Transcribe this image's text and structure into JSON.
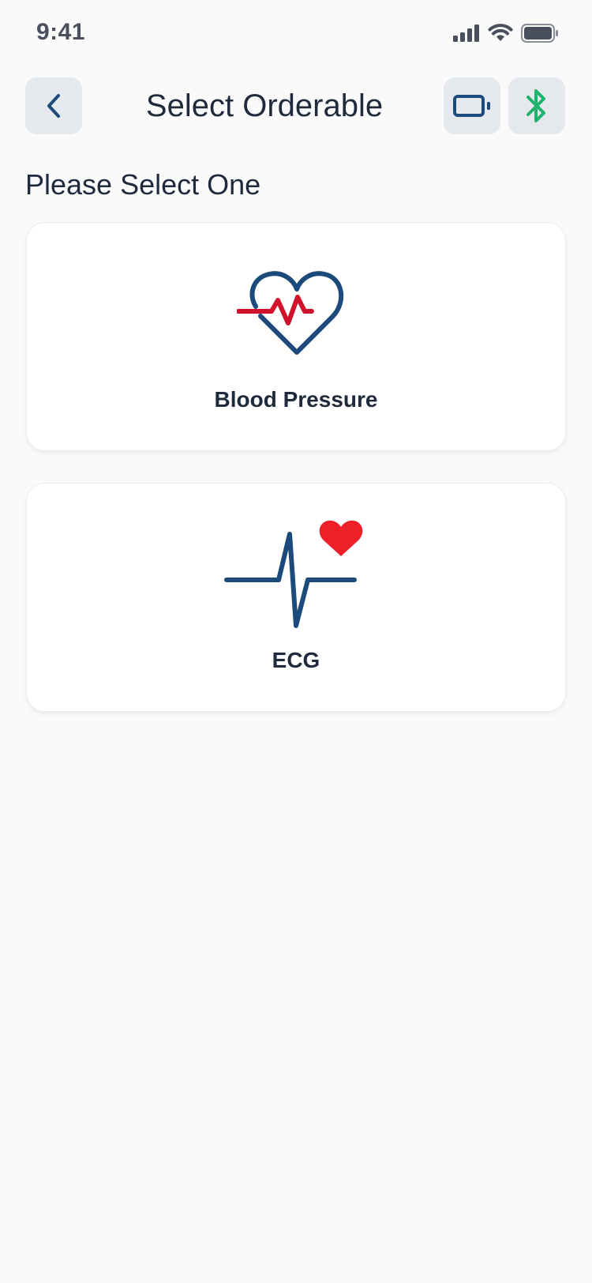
{
  "status_bar": {
    "time": "9:41"
  },
  "header": {
    "title": "Select Orderable",
    "back_icon": "chevron-left-icon",
    "device_icon": "device-icon",
    "bluetooth_icon": "bluetooth-icon"
  },
  "main": {
    "heading": "Please Select One",
    "options": [
      {
        "label": "Blood Pressure",
        "icon": "heart-pulse-icon"
      },
      {
        "label": "ECG",
        "icon": "ecg-heart-icon"
      }
    ]
  },
  "colors": {
    "background": "#fafafa",
    "navy": "#1c4a7a",
    "red": "#d1122d",
    "heart_red": "#ee1f26",
    "bluetooth_green": "#1fb36b",
    "button_bg": "#e5e9ee"
  }
}
